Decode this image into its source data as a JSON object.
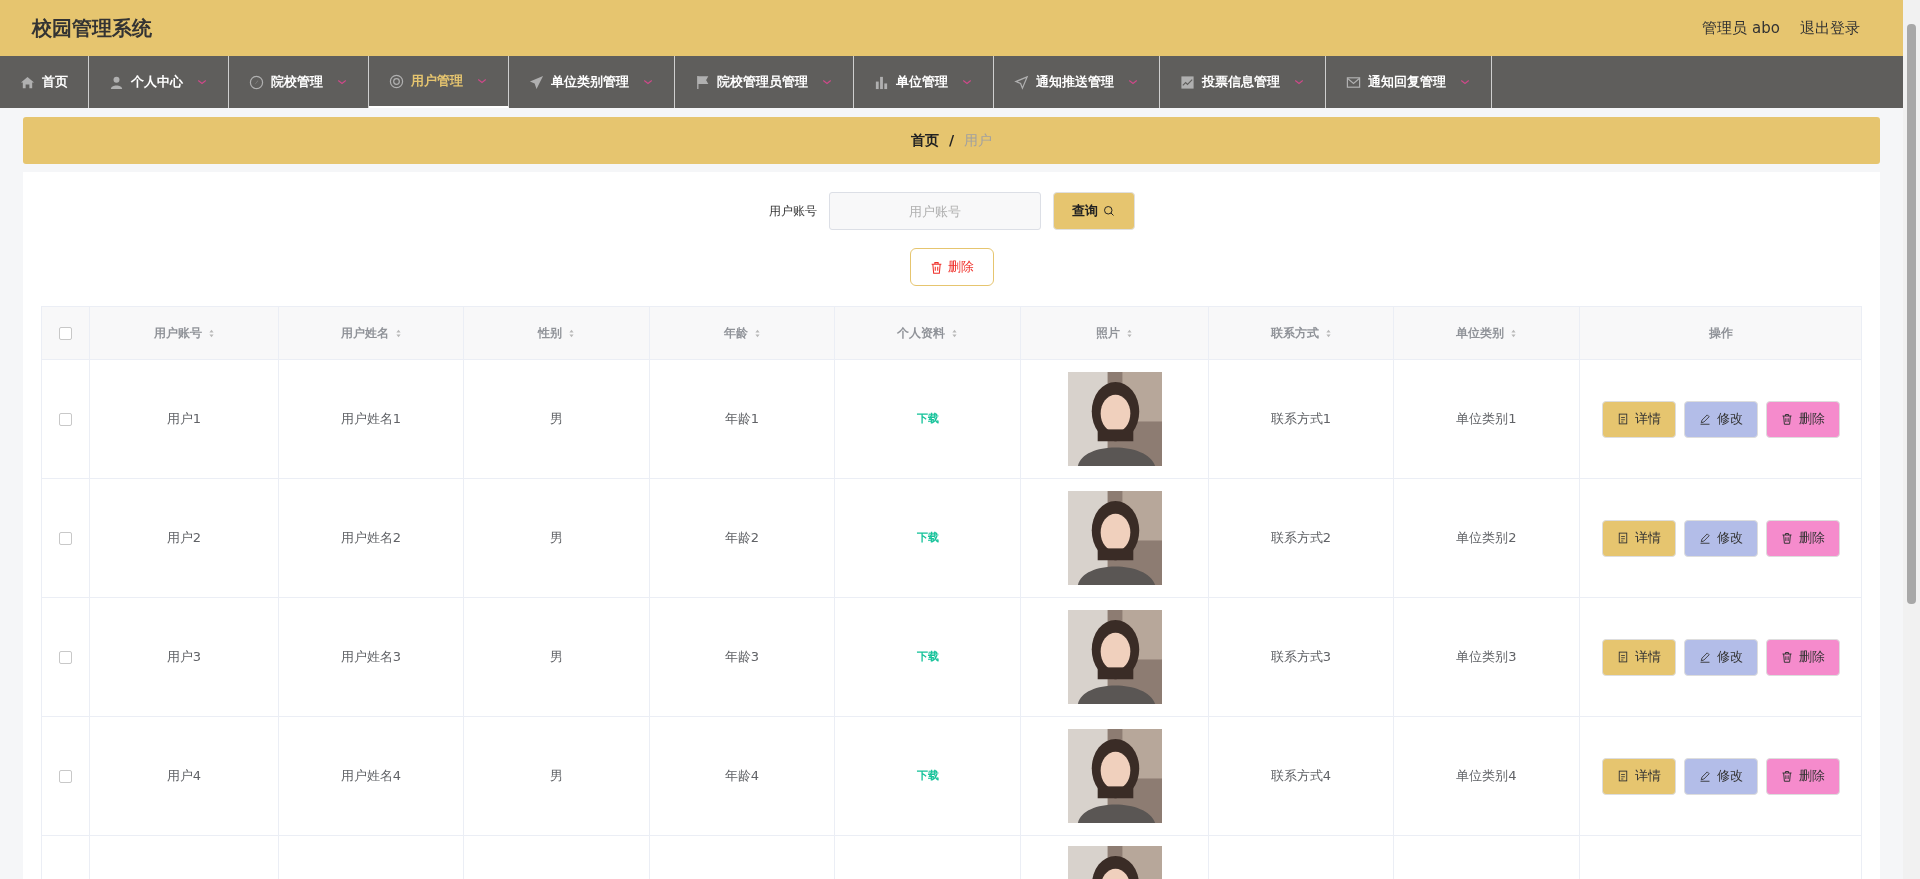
{
  "header": {
    "title": "校园管理系统",
    "user": "管理员 abo",
    "logout": "退出登录"
  },
  "nav": [
    {
      "label": "首页",
      "selected": false,
      "dropdown": false
    },
    {
      "label": "个人中心",
      "selected": false,
      "dropdown": true
    },
    {
      "label": "院校管理",
      "selected": false,
      "dropdown": true
    },
    {
      "label": "用户管理",
      "selected": true,
      "dropdown": true
    },
    {
      "label": "单位类别管理",
      "selected": false,
      "dropdown": true
    },
    {
      "label": "院校管理员管理",
      "selected": false,
      "dropdown": true
    },
    {
      "label": "单位管理",
      "selected": false,
      "dropdown": true
    },
    {
      "label": "通知推送管理",
      "selected": false,
      "dropdown": true
    },
    {
      "label": "投票信息管理",
      "selected": false,
      "dropdown": true
    },
    {
      "label": "通知回复管理",
      "selected": false,
      "dropdown": true
    }
  ],
  "breadcrumb": {
    "items": [
      "首页",
      "用户"
    ],
    "separator": "/"
  },
  "search": {
    "label": "用户账号",
    "placeholder": "用户账号",
    "button": "查询"
  },
  "delete_button": "删除",
  "table": {
    "all_checked": false,
    "columns": [
      {
        "label": "用户账号",
        "sortable": true
      },
      {
        "label": "用户姓名",
        "sortable": true
      },
      {
        "label": "性别",
        "sortable": true
      },
      {
        "label": "年龄",
        "sortable": true
      },
      {
        "label": "个人资料",
        "sortable": true
      },
      {
        "label": "照片",
        "sortable": true
      },
      {
        "label": "联系方式",
        "sortable": true
      },
      {
        "label": "单位类别",
        "sortable": true
      },
      {
        "label": "操作",
        "sortable": false
      }
    ],
    "rows": [
      {
        "checked": false,
        "account": "用户1",
        "name": "用户姓名1",
        "gender": "男",
        "age": "年龄1",
        "file": "下载",
        "photo": {
          "kind": "picture"
        },
        "contact": "联系方式1",
        "category": "单位类别1",
        "actions": [
          "详情",
          "修改",
          "删除"
        ]
      },
      {
        "checked": false,
        "account": "用户2",
        "name": "用户姓名2",
        "gender": "男",
        "age": "年龄2",
        "file": "下载",
        "photo": {
          "kind": "picture"
        },
        "contact": "联系方式2",
        "category": "单位类别2",
        "actions": [
          "详情",
          "修改",
          "删除"
        ]
      },
      {
        "checked": false,
        "account": "用户3",
        "name": "用户姓名3",
        "gender": "男",
        "age": "年龄3",
        "file": "下载",
        "photo": {
          "kind": "picture"
        },
        "contact": "联系方式3",
        "category": "单位类别3",
        "actions": [
          "详情",
          "修改",
          "删除"
        ]
      },
      {
        "checked": false,
        "account": "用户4",
        "name": "用户姓名4",
        "gender": "男",
        "age": "年龄4",
        "file": "下载",
        "photo": {
          "kind": "picture"
        },
        "contact": "联系方式4",
        "category": "单位类别4",
        "actions": [
          "详情",
          "修改",
          "删除"
        ]
      }
    ]
  }
}
